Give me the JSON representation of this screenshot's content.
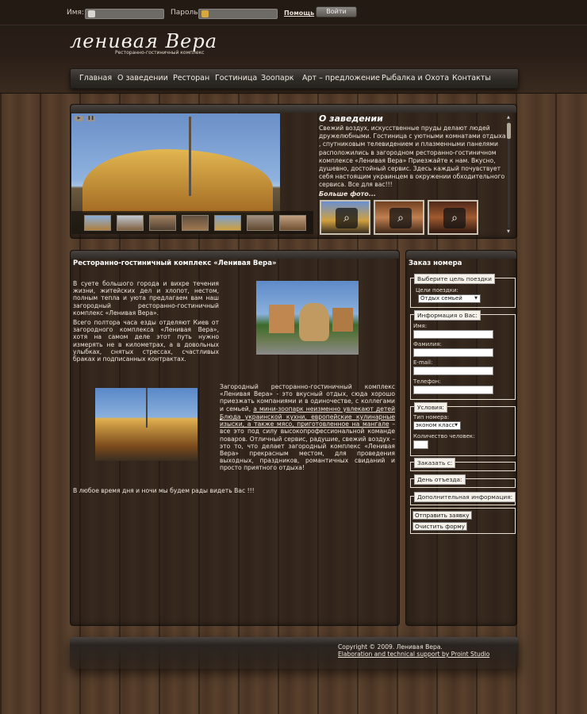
{
  "login": {
    "name_label": "Имя:",
    "password_label": "Пароль:",
    "help_label": "Помощь",
    "submit_label": "Войти"
  },
  "site": {
    "logo": "ленивая Вера",
    "tagline": "Ресторанно-гостиничный комплекс"
  },
  "nav": {
    "items": [
      "Главная",
      "О заведении",
      "Ресторан",
      "Гостиница",
      "Зоопарк",
      "Арт – предложение",
      "Рыбалка и Охота",
      "Контакты"
    ]
  },
  "slider": {
    "about_title": "О заведении",
    "about_text": "Свежий воздух, искусственные пруды делают людей дружелюбными. Гостиница с уютными комнатами отдыха , спутниковым телевидением и плазменными панелями расположились в загородном ресторанно-гостиничном комплексе «Ленивая Вера» Приезжайте к нам. Вкусно, душевно, достойный сервис. Здесь каждый почувствует себя настоящим украинцем в окружении обходительного сервиса. Все для вас!!!",
    "more_photos": "Больше фото..."
  },
  "content": {
    "title": "Ресторанно-гостиничный комплекс «Ленивая Вера»",
    "p1": "В суете большого города и вихре течения жизни, житейских дел и хлопот, нестом, полным тепла и уюта предлагаем вам наш загородный ресторанно-гостиничный комплекс «Ленивая Вера».",
    "p2": "Всего полтора часа езды отделяют Киев от загородного комплекса «Ленивая Вера», хотя на самом деле этот путь нужно измерять не в километрах, а в довольных улыбках, снятых стрессах, счастливых браках и подписанных контрактах.",
    "p3_text": "Загородный ресторанно-гостиничный комплекс «Ленивая Вера» - это вкусный отдых, сюда хорошо приезжать компаниями и в одиночестве, с коллегами и семьей,",
    "p3_link": "а мини-зоопарк неизменно увлекают детей .",
    "p4_link": "Блюда украинской кухни, европейские кулинарные изыски, а также мясо, приготовленное на мангале",
    "p4_text": " – все это под силу высокопрофессиональной команде поваров. Отличный сервис, радушие, свежий воздух – это то, что делает загородный комплекс «Ленивая Вера» прекрасным местом, для проведения выходных, праздников, романтичных свиданий и просто приятного отдыха!",
    "p5": "В любое время дня и ночи мы будем рады видеть Вас !!!"
  },
  "order": {
    "title": "Заказ номера",
    "purpose_legend": "Выберите цель поездки",
    "purpose_label": "Цели поездки:",
    "purpose_value": "Отдых семьей",
    "info_legend": "Информация о Вас:",
    "name_label": "Имя:",
    "surname_label": "Фамилия:",
    "email_label": "E-mail:",
    "phone_label": "Телефон:",
    "conditions_legend": "Условия:",
    "room_type_label": "Тип номера:",
    "room_type_value": "эконом класс",
    "people_label": "Количество человек:",
    "order_from_legend": "Заказать с:",
    "departure_legend": "День отъезда:",
    "extra_legend": "Дополнительная информация:",
    "submit_label": "Отправить заявку",
    "reset_label": "Очистить форму"
  },
  "footer": {
    "copyright": "Copyright © 2009. Ленивая Вера.",
    "support": "Elaboration and technical support by Proint Studio"
  }
}
